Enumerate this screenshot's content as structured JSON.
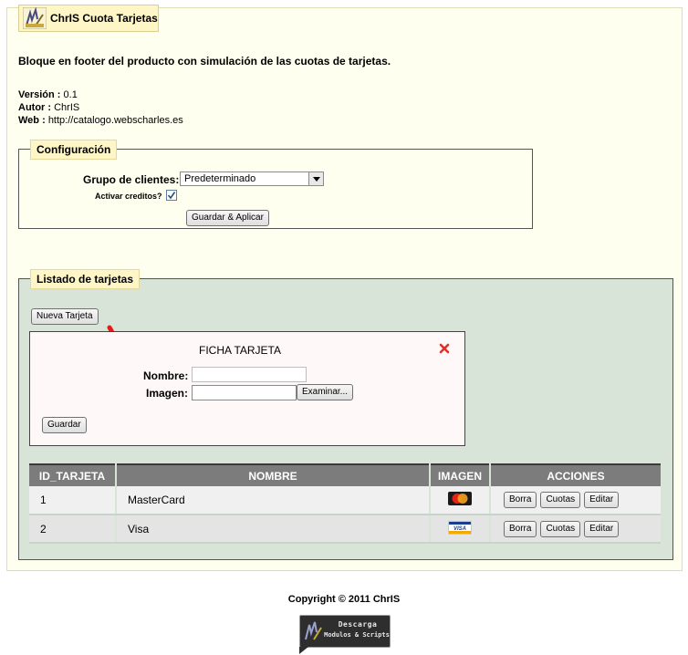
{
  "header": {
    "title": "ChrIS Cuota Tarjetas",
    "description": "Bloque en footer del producto con simulación de las cuotas de tarjetas."
  },
  "meta": {
    "version_label": "Versión :",
    "version_value": "0.1",
    "author_label": "Autor :",
    "author_value": "ChrIS",
    "web_label": "Web :",
    "web_value": "http://catalogo.webscharles.es"
  },
  "config": {
    "legend": "Configuración",
    "client_group_label": "Grupo de clientes:",
    "client_group_value": "Predeterminado",
    "credits_label": "Activar creditos?",
    "credits_checked": true,
    "save_apply_label": "Guardar & Aplicar"
  },
  "cards": {
    "legend": "Listado de tarjetas",
    "new_card_label": "Nueva Tarjeta",
    "form": {
      "title": "FICHA TARJETA",
      "name_label": "Nombre:",
      "name_value": "",
      "image_label": "Imagen:",
      "browse_label": "Examinar...",
      "save_label": "Guardar"
    },
    "table": {
      "headers": [
        "ID_TARJETA",
        "NOMBRE",
        "IMAGEN",
        "ACCIONES"
      ],
      "rows": [
        {
          "id": "1",
          "name": "MasterCard",
          "image": "mastercard-logo"
        },
        {
          "id": "2",
          "name": "Visa",
          "image": "visa-logo"
        }
      ],
      "actions": {
        "delete": "Borra",
        "fees": "Cuotas",
        "edit": "Editar"
      }
    }
  },
  "footer": {
    "copyright": "Copyright © 2011 ChrIS",
    "badge_line1": "Descarga",
    "badge_line2": "Modulos & Scripts"
  },
  "colors": {
    "panel_bg": "#fffff0",
    "list_bg": "#d8e4d8",
    "tab_bg": "#fff6c8",
    "close_red": "#e0302a",
    "arrow_red": "#e81818"
  }
}
